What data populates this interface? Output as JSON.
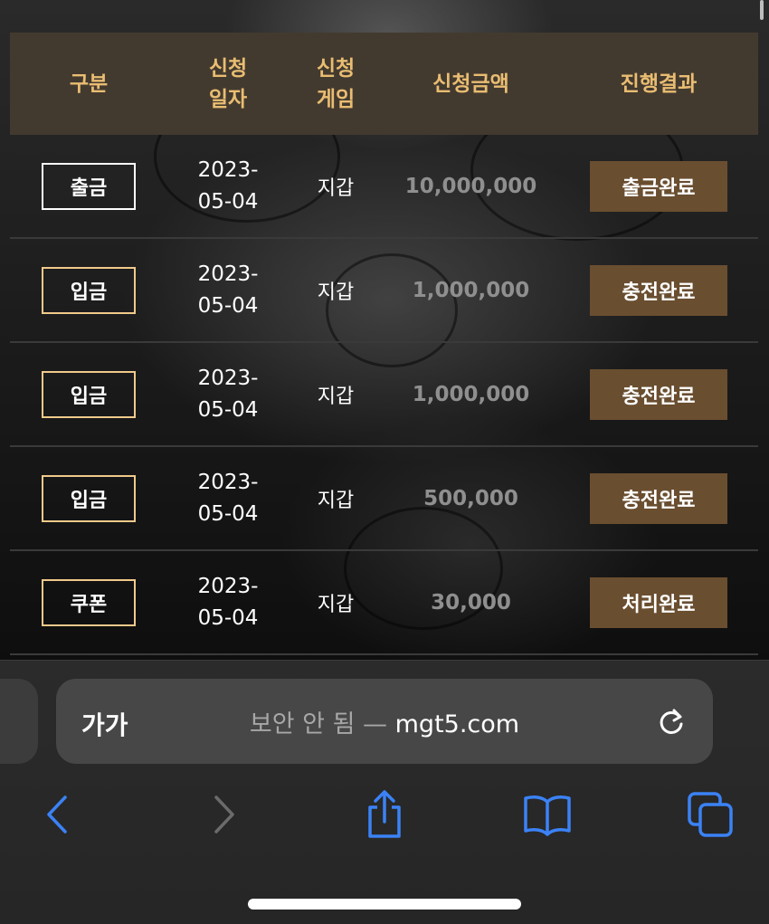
{
  "table": {
    "headers": {
      "type": "구분",
      "date": "신청일자",
      "game": "신청게임",
      "amount": "신청금액",
      "result": "진행결과"
    },
    "rows": [
      {
        "type": "출금",
        "date": "2023-05-04",
        "game": "지갑",
        "amount": "10,000,000",
        "result": "출금완료",
        "type_border": "white"
      },
      {
        "type": "입금",
        "date": "2023-05-04",
        "game": "지갑",
        "amount": "1,000,000",
        "result": "충전완료",
        "type_border": "gold"
      },
      {
        "type": "입금",
        "date": "2023-05-04",
        "game": "지갑",
        "amount": "1,000,000",
        "result": "충전완료",
        "type_border": "gold"
      },
      {
        "type": "입금",
        "date": "2023-05-04",
        "game": "지갑",
        "amount": "500,000",
        "result": "충전완료",
        "type_border": "gold"
      },
      {
        "type": "쿠폰",
        "date": "2023-05-04",
        "game": "지갑",
        "amount": "30,000",
        "result": "처리완료",
        "type_border": "gold"
      }
    ]
  },
  "browser": {
    "text_size_label": "가가",
    "security_label": "보안 안 됨",
    "separator": "—",
    "domain": "mgt5.com",
    "icons": {
      "reload": "reload-icon",
      "back": "chevron-left-icon",
      "forward": "chevron-right-icon",
      "share": "share-icon",
      "bookmarks": "book-icon",
      "tabs": "tabs-icon"
    }
  },
  "colors": {
    "header_bg": "#433a2f",
    "header_text": "#e9bd72",
    "status_bg": "#6a4e30",
    "accent_blue": "#3b82f6"
  }
}
